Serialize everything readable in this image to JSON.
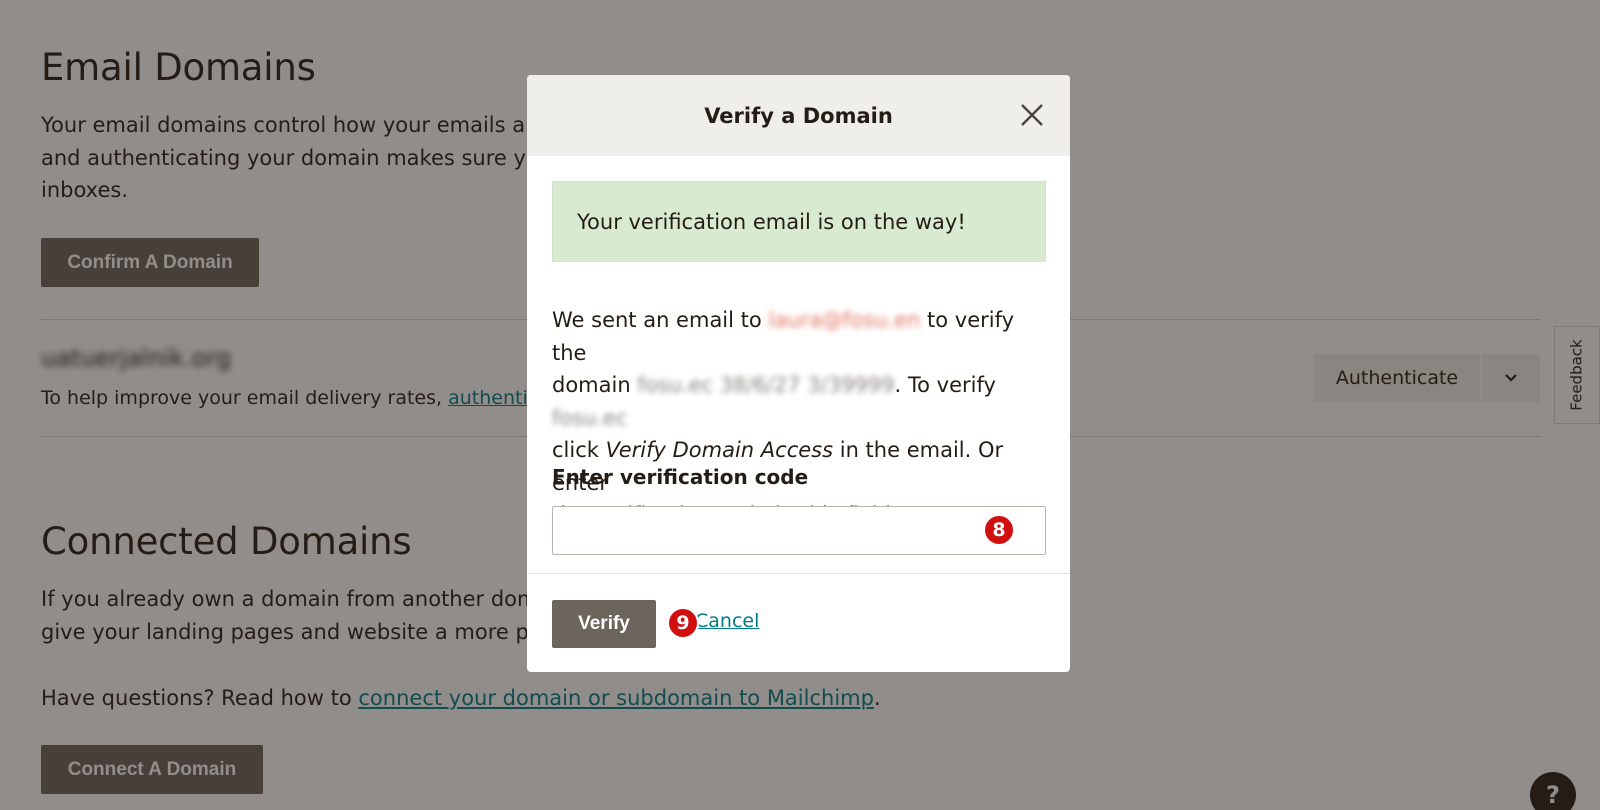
{
  "page": {
    "email_domains": {
      "title": "Email Domains",
      "description_line1": "Your email domains control how your emails are",
      "description_line2": "and authenticating your domain makes sure you",
      "description_line3": "inboxes.",
      "confirm_button": "Confirm A Domain",
      "domain_row": {
        "domain_name": "uatuerjalnik.org",
        "help_text": "To help improve your email delivery rates, ",
        "help_link": "authenticate",
        "authenticate_button": "Authenticate"
      }
    },
    "connected_domains": {
      "title": "Connected Domains",
      "description_line1": "If you already own a domain from another doma",
      "description_line2": "give your landing pages and website a more pro",
      "questions_prefix": "Have questions? Read how to ",
      "questions_link": "connect your domain or subdomain to Mailchimp",
      "questions_suffix": ".",
      "connect_button": "Connect A Domain"
    },
    "feedback_tab": "Feedback",
    "help_button": "?"
  },
  "modal": {
    "title": "Verify a Domain",
    "alert": "Your verification email is on the way!",
    "body": {
      "part1": "We sent an email to ",
      "email_redacted": "laura@fosu.en",
      "part2": " to verify the",
      "part3": "domain ",
      "domain_redacted": "fosu.ec 38/6/27 3/39999",
      "part4": ". To verify ",
      "domain_short_redacted": "fosu.ec",
      "part5": "click ",
      "emphasis": "Verify Domain Access",
      "part6": " in the email. Or enter",
      "part7": "the verification code in this field."
    },
    "field_label": "Enter verification code",
    "input_value": "",
    "input_badge": "8",
    "verify_button": "Verify",
    "cancel_badge": "9",
    "cancel_link": "Cancel"
  }
}
